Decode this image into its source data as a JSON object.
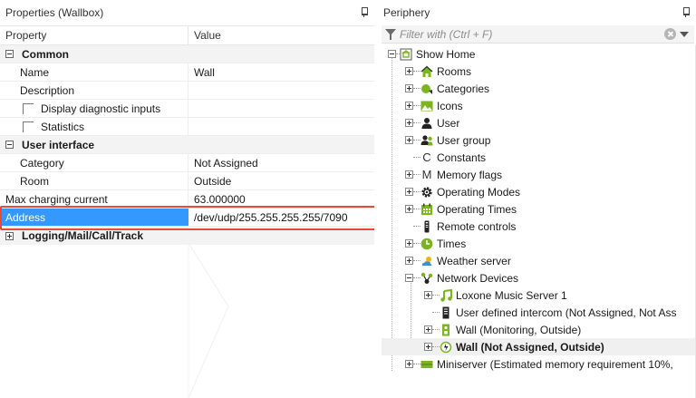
{
  "properties": {
    "title": "Properties (Wallbox)",
    "header": {
      "property": "Property",
      "value": "Value"
    },
    "categories": {
      "common": "Common",
      "user_interface": "User interface",
      "logging": "Logging/Mail/Call/Track"
    },
    "rows": {
      "name": {
        "label": "Name",
        "value": "Wall"
      },
      "description": {
        "label": "Description",
        "value": ""
      },
      "display_diag": {
        "label": "Display diagnostic inputs"
      },
      "statistics": {
        "label": "Statistics"
      },
      "category": {
        "label": "Category",
        "value": "Not Assigned"
      },
      "room": {
        "label": "Room",
        "value": "Outside"
      },
      "max_charging": {
        "label": "Max charging current",
        "value": "63.000000"
      },
      "address": {
        "label": "Address",
        "value": "/dev/udp/255.255.255.255/7090"
      }
    }
  },
  "periphery": {
    "title": "Periphery",
    "filter_placeholder": "Filter with (Ctrl + F)",
    "tree": {
      "root": "Show Home",
      "rooms": "Rooms",
      "categories": "Categories",
      "icons": "Icons",
      "user": "User",
      "user_group": "User group",
      "constants": "Constants",
      "memory_flags": "Memory flags",
      "operating_modes": "Operating Modes",
      "operating_times": "Operating Times",
      "remote_controls": "Remote controls",
      "times": "Times",
      "weather_server": "Weather server",
      "network_devices": "Network Devices",
      "music_server": "Loxone Music Server 1",
      "intercom": "User defined intercom (Not Assigned, Not Ass",
      "wall_monitoring": "Wall (Monitoring, Outside)",
      "wall_selected": "Wall (Not Assigned, Outside)",
      "miniserver": "Miniserver (Estimated memory requirement 10%,"
    }
  },
  "colors": {
    "selection": "#3399ff",
    "highlight_border": "#e84a3a",
    "green_icon": "#7ab51d"
  }
}
